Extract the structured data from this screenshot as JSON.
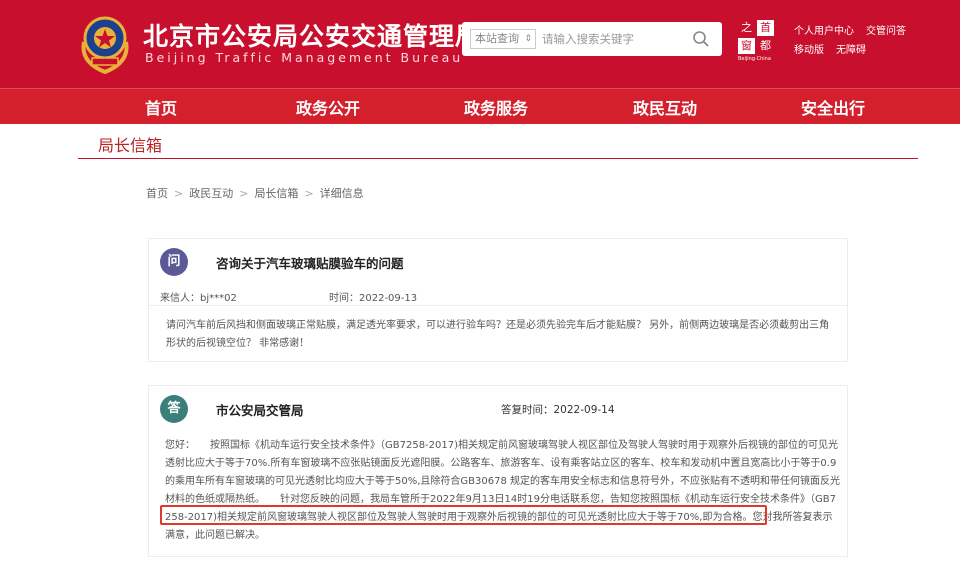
{
  "header": {
    "site_title": "北京市公安局公安交通管理局",
    "site_subtitle": "Beijing Traffic Management Bureau",
    "search_scope": "本站查询",
    "search_placeholder": "请输入搜索关键字",
    "capital_logo": {
      "chars": [
        "之",
        "首",
        "窗",
        "都"
      ],
      "caption": "Beijing·China"
    },
    "top_links": [
      "个人用户中心",
      "交管问答",
      "移动版",
      "无障碍"
    ]
  },
  "nav": [
    "首页",
    "政务公开",
    "政务服务",
    "政民互动",
    "安全出行"
  ],
  "section_title": "局长信箱",
  "breadcrumb": [
    "首页",
    "政民互动",
    "局长信箱",
    "详细信息"
  ],
  "question": {
    "badge": "问",
    "title": "咨询关于汽车玻璃贴膜验车的问题",
    "sender": "来信人：bj***02",
    "time": "时间：2022-09-13",
    "body": "请问汽车前后风挡和侧面玻璃正常贴膜，满足透光率要求，可以进行验车吗？还是必须先验完车后才能贴膜？ 另外，前侧两边玻璃是否必须截剪出三角形状的后视镜空位？ 非常感谢！"
  },
  "answer": {
    "badge": "答",
    "title": "市公安局交管局",
    "reply_time": "答复时间：2022-09-14",
    "body": "您好：　　按照国标《机动车运行安全技术条件》（GB7258-2017)相关规定前风窗玻璃驾驶人视区部位及驾驶人驾驶时用于观察外后视镜的部位的可见光透射比应大于等于70%.所有车窗玻璃不应张贴镜面反光遮阳膜。公路客车、旅游客车、设有乘客站立区的客车、校车和发动机中置且宽高比小于等于0.9的乘用车所有车窗玻璃的可见光透射比均应大于等于50%,且除符合GB30678 规定的客车用安全标志和信息符号外，不应张贴有不透明和带任何镜面反光材料的色纸或隔热纸。　　针对您反映的问题，我局车管所于2022年9月13日14时19分电话联系您，告知您按照国标《机动车运行安全技术条件》（GB7258-2017)相关规定前风窗玻璃驾驶人视区部位及驾驶人驾驶时用于观察外后视镜的部位的可见光透射比应大于等于70%,即为合格。您对我所答复表示满意，此问题已解决。"
  },
  "colors": {
    "header_bg": "#c8102e",
    "nav_bg": "#d4202d",
    "question_badge": "#5c5a96",
    "answer_badge": "#3a7f79",
    "highlight_border": "#e0382b"
  }
}
